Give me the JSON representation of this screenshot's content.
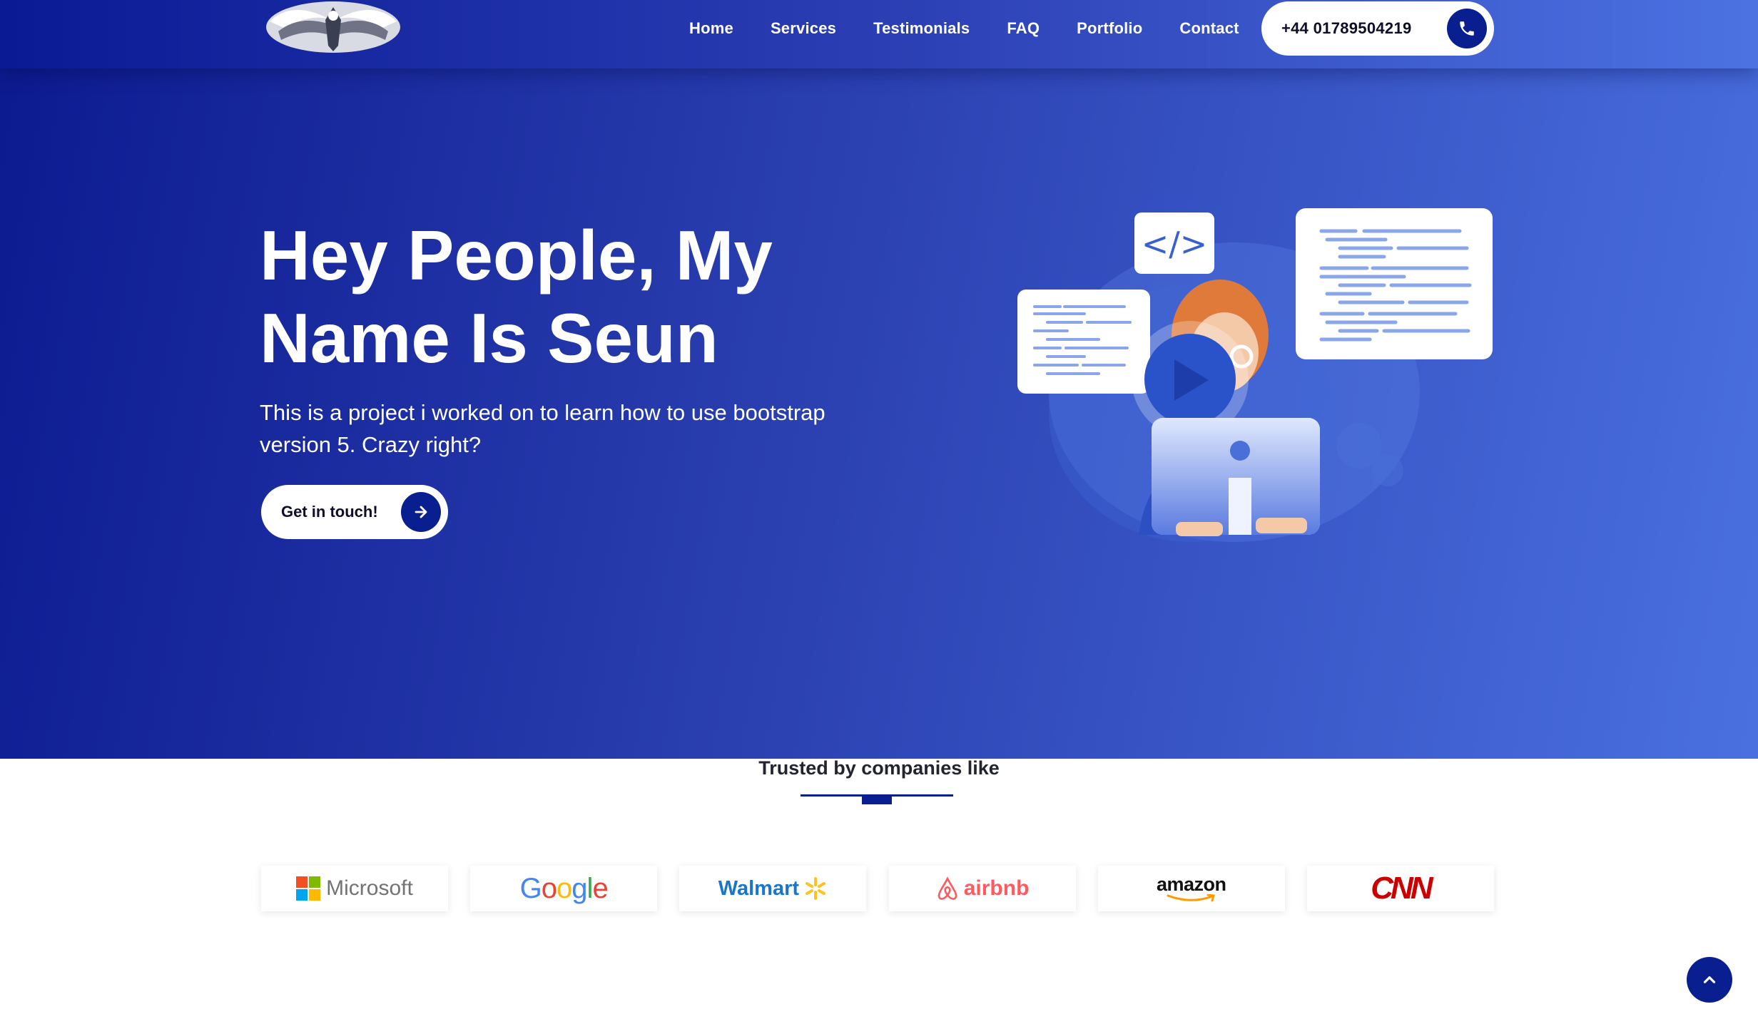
{
  "nav": {
    "links": [
      "Home",
      "Services",
      "Testimonials",
      "FAQ",
      "Portfolio",
      "Contact"
    ],
    "phone": "+44 01789504219",
    "logo_icon": "eagle-emblem-icon",
    "phone_icon": "phone-icon"
  },
  "hero": {
    "title_line1": "Hey People, My",
    "title_line2": "Name Is Seun",
    "subtitle": "This is a project i worked on to learn how to use bootstrap version 5. Crazy right?",
    "cta_label": "Get in touch!",
    "cta_icon": "arrow-right-icon",
    "illustration_code_tag": "</>"
  },
  "trusted": {
    "title": "Trusted by companies like",
    "companies": [
      "Microsoft",
      "Google",
      "Walmart",
      "airbnb",
      "amazon",
      "CNN"
    ]
  },
  "scroll_top_icon": "chevron-up-icon",
  "colors": {
    "navy": "#0a1f8f",
    "hero_start": "#0c1a90",
    "hero_end": "#4a70e0",
    "white": "#ffffff"
  }
}
